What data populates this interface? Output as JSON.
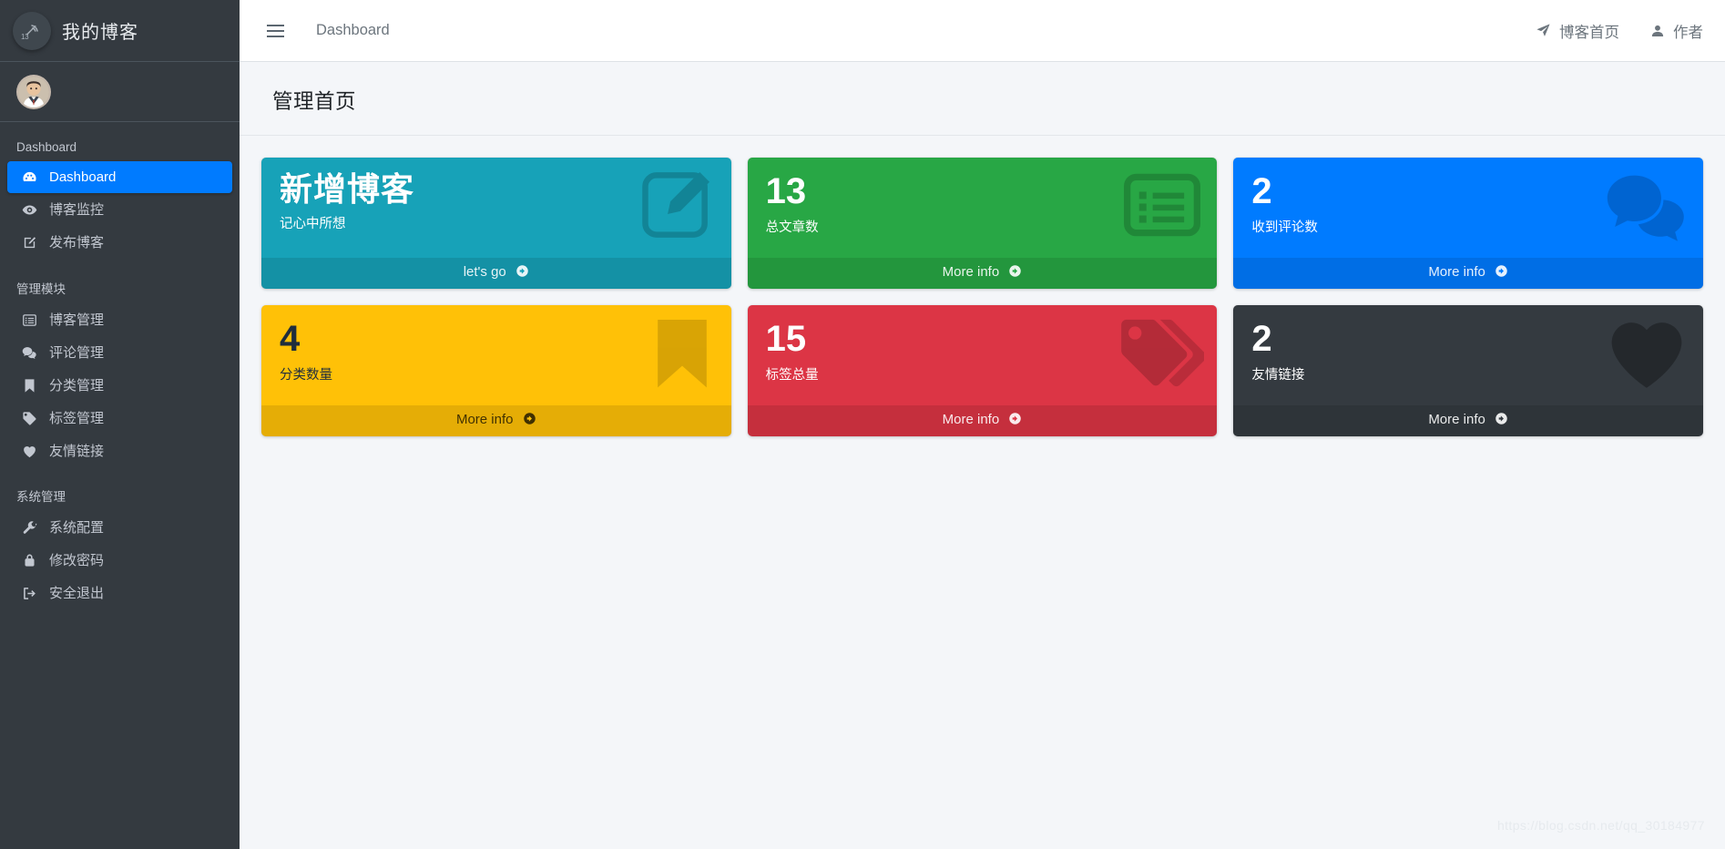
{
  "sidebar": {
    "brand": {
      "title": "我的博客",
      "logo_icon": "wifi-logo-icon",
      "logo_number": "13"
    },
    "user": {
      "avatar_icon": "user-avatar"
    },
    "groups": [
      {
        "header": "Dashboard",
        "items": [
          {
            "label": "Dashboard",
            "icon": "tachometer-icon",
            "active": true
          },
          {
            "label": "博客监控",
            "icon": "eye-icon",
            "active": false
          },
          {
            "label": "发布博客",
            "icon": "edit-square-icon",
            "active": false
          }
        ]
      },
      {
        "header": "管理模块",
        "items": [
          {
            "label": "博客管理",
            "icon": "list-icon",
            "active": false
          },
          {
            "label": "评论管理",
            "icon": "comments-icon",
            "active": false
          },
          {
            "label": "分类管理",
            "icon": "bookmark-icon",
            "active": false
          },
          {
            "label": "标签管理",
            "icon": "tag-icon",
            "active": false
          },
          {
            "label": "友情链接",
            "icon": "heart-icon",
            "active": false
          }
        ]
      },
      {
        "header": "系统管理",
        "items": [
          {
            "label": "系统配置",
            "icon": "wrench-icon",
            "active": false
          },
          {
            "label": "修改密码",
            "icon": "lock-icon",
            "active": false
          },
          {
            "label": "安全退出",
            "icon": "sign-out-icon",
            "active": false
          }
        ]
      }
    ]
  },
  "topbar": {
    "menu_toggle_icon": "hamburger-icon",
    "breadcrumb": "Dashboard",
    "right_links": [
      {
        "label": "博客首页",
        "icon": "paper-plane-icon"
      },
      {
        "label": "作者",
        "icon": "user-icon"
      }
    ]
  },
  "content": {
    "page_title": "管理首页",
    "watermark": "https://blog.csdn.net/qq_30184977",
    "cards": [
      {
        "value": "新增博客",
        "value_is_text": true,
        "label": "记心中所想",
        "footer": "let's go",
        "icon": "pen-square-icon",
        "bg": "#17a2b8",
        "dark_text": false
      },
      {
        "value": "13",
        "value_is_text": false,
        "label": "总文章数",
        "footer": "More info",
        "icon": "list-alt-icon",
        "bg": "#28a745",
        "dark_text": false
      },
      {
        "value": "2",
        "value_is_text": false,
        "label": "收到评论数",
        "footer": "More info",
        "icon": "comments-icon",
        "bg": "#007bff",
        "dark_text": false
      },
      {
        "value": "4",
        "value_is_text": false,
        "label": "分类数量",
        "footer": "More info",
        "icon": "bookmark-icon",
        "bg": "#ffc107",
        "dark_text": true
      },
      {
        "value": "15",
        "value_is_text": false,
        "label": "标签总量",
        "footer": "More info",
        "icon": "tags-icon",
        "bg": "#dc3545",
        "dark_text": false
      },
      {
        "value": "2",
        "value_is_text": false,
        "label": "友情链接",
        "footer": "More info",
        "icon": "heart-icon",
        "bg": "#343a40",
        "dark_text": false
      }
    ]
  },
  "colors": {
    "sidebar_bg": "#343a40",
    "active_accent": "#007bff",
    "content_bg": "#f4f6f9",
    "topbar_bg": "#ffffff"
  }
}
